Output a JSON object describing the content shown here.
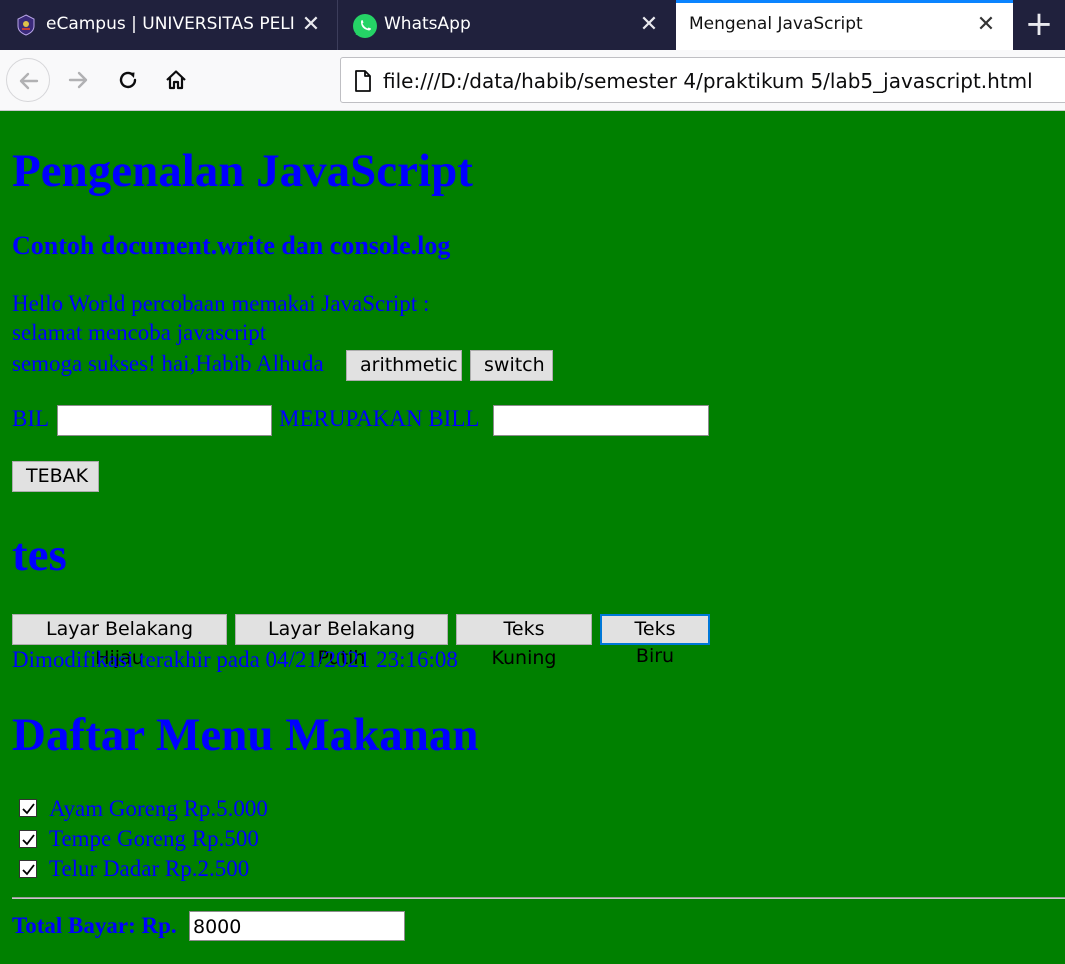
{
  "browser": {
    "tabs": [
      {
        "title": "eCampus | UNIVERSITAS PELITA",
        "favicon": "university-logo-icon",
        "active": false
      },
      {
        "title": "WhatsApp",
        "favicon": "whatsapp-icon",
        "active": false
      },
      {
        "title": "Mengenal JavaScript",
        "favicon": "",
        "active": true
      }
    ],
    "close_glyph": "✕",
    "new_tab_glyph": "+",
    "url": "file:///D:/data/habib/semester 4/praktikum 5/lab5_javascript.html",
    "accent_color": "#0a84ff"
  },
  "page": {
    "background_color": "#008000",
    "text_color": "#0000ff",
    "heading_main": "Pengenalan JavaScript",
    "subheading": "Contoh document.write dan console.log",
    "lines": [
      "Hello World percobaan memakai JavaScript :",
      "selamat mencoba javascript",
      "semoga sukses! hai,Habib Alhuda"
    ],
    "buttons_row1": {
      "arithmetic": "arithmetic",
      "switch": "switch"
    },
    "guess_form": {
      "bil_label": "BIL",
      "bil_value": "",
      "result_label": "MERUPAKAN BILL",
      "result_value": "",
      "guess_button": "TEBAK"
    },
    "heading_tes": "tes",
    "color_buttons": {
      "green_bg": "Layar Belakang Hijau",
      "white_bg": "Layar Belakang Putih",
      "yellow_text": "Teks Kuning",
      "blue_text": "Teks Biru"
    },
    "modified_text": "Dimodifikasi terakhir pada 04/21/2021 23:16:08",
    "menu_heading": "Daftar Menu Makanan",
    "menu_items": [
      {
        "label": "Ayam Goreng Rp.5.000",
        "checked": true
      },
      {
        "label": "Tempe Goreng Rp.500",
        "checked": true
      },
      {
        "label": "Telur Dadar Rp.2.500",
        "checked": true
      }
    ],
    "total_label": "Total Bayar: Rp.",
    "total_value": "8000"
  }
}
